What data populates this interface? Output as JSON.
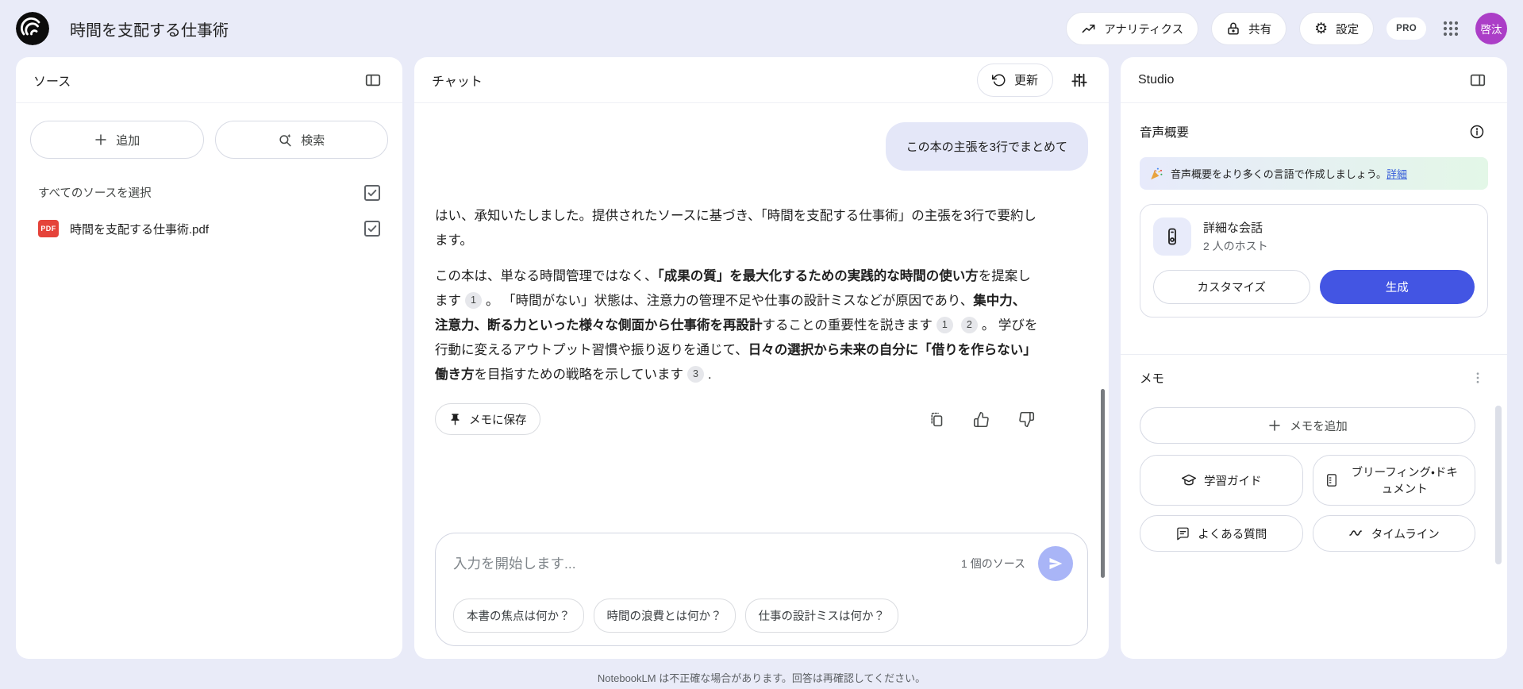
{
  "header": {
    "title": "時間を支配する仕事術",
    "analytics_label": "アナリティクス",
    "share_label": "共有",
    "settings_label": "設定",
    "pro_badge": "PRO",
    "avatar_text": "啓汰"
  },
  "icons": {
    "settings_glyph": "⚙"
  },
  "sources_panel": {
    "title": "ソース",
    "add_button": "追加",
    "search_button": "検索",
    "select_all_label": "すべてのソースを選択",
    "sources": [
      {
        "name": "時間を支配する仕事術.pdf",
        "type": "PDF",
        "checked": true
      }
    ]
  },
  "chat_panel": {
    "title": "チャット",
    "refresh_button": "更新",
    "user_message": "この本の主張を3行でまとめて",
    "assistant": {
      "p1": "はい、承知いたしました。提供されたソースに基づき、「時間を支配する仕事術」の主張を3行で要約します。",
      "p2_segments": [
        {
          "t": "n",
          "v": "この本は、単なる時間管理ではなく、"
        },
        {
          "t": "b",
          "v": "「成果の質」を最大化するための実践的な時間の使い方"
        },
        {
          "t": "n",
          "v": "を提案します"
        },
        {
          "t": "c",
          "v": "1"
        },
        {
          "t": "n",
          "v": "。 「時間がない」状態は、注意力の管理不足や仕事の設計ミスなどが原因であり、"
        },
        {
          "t": "b",
          "v": "集中力、注意力、断る力といった様々な側面から仕事術を再設計"
        },
        {
          "t": "n",
          "v": "することの重要性を説きます"
        },
        {
          "t": "c",
          "v": "1"
        },
        {
          "t": "c",
          "v": "2"
        },
        {
          "t": "n",
          "v": "。 学びを行動に変えるアウトプット習慣や振り返りを通じて、"
        },
        {
          "t": "b",
          "v": "日々の選択から未来の自分に「借りを作らない」働き方"
        },
        {
          "t": "n",
          "v": "を目指すための戦略を示しています"
        },
        {
          "t": "c",
          "v": "3"
        },
        {
          "t": "n",
          "v": "."
        }
      ]
    },
    "save_note_button": "メモに保存",
    "input": {
      "placeholder": "入力を開始します...",
      "source_count": "1 個のソース"
    },
    "suggestions": [
      "本書の焦点は何か？",
      "時間の浪費とは何か？",
      "仕事の設計ミスは何か？"
    ],
    "disclaimer": "NotebookLM は不正確な場合があります。回答は再確認してください。"
  },
  "studio_panel": {
    "title": "Studio",
    "audio_section": {
      "title": "音声概要",
      "banner_text": "音声概要をより多くの言語で作成しましょう。",
      "banner_link": "詳細",
      "card_title": "詳細な会話",
      "card_subtitle": "2 人のホスト",
      "customize_button": "カスタマイズ",
      "generate_button": "生成"
    },
    "notes_section": {
      "title": "メモ",
      "add_note_button": "メモを追加",
      "tools": [
        "学習ガイド",
        "ブリーフィング・ドキュメント",
        "よくある質問",
        "タイムライン"
      ]
    }
  },
  "colors": {
    "page_background": "#E9EBF8",
    "primary_blue": "#4355E3",
    "send_button": "#A9B5F7",
    "user_bubble": "#E4E7F8",
    "avatar_purple": "#AB3EC7",
    "pdf_red": "#E5433A",
    "banner_gradient_start": "#E7EAFB",
    "banner_gradient_end": "#E3F7E7",
    "link_blue": "#3059D9"
  }
}
